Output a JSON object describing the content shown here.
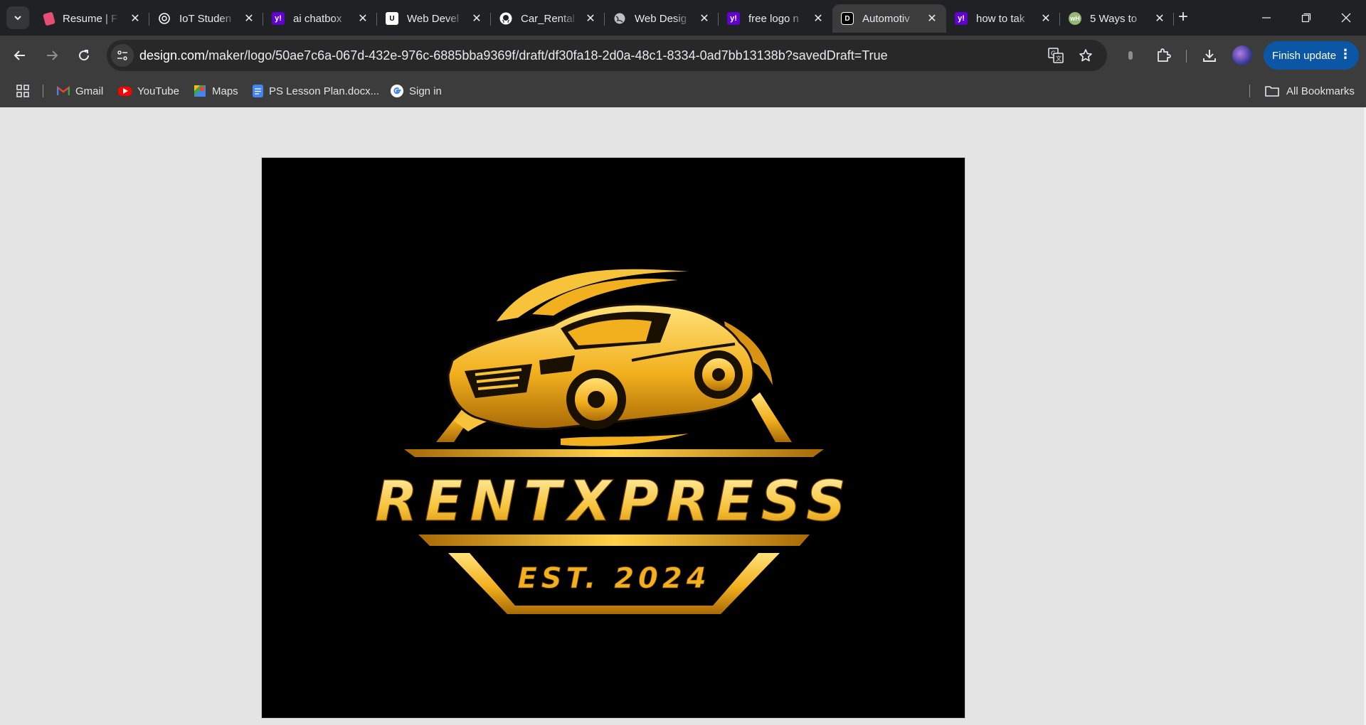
{
  "browser": {
    "tabs": [
      {
        "title": "Resume | F",
        "icon": "resume-app-icon",
        "color": "#e84d73"
      },
      {
        "title": "IoT Studen",
        "icon": "chatgpt-icon",
        "color": "#ffffff"
      },
      {
        "title": "ai chatbox",
        "icon": "yahoo-icon",
        "color": "#6001d2"
      },
      {
        "title": "Web Devel",
        "icon": "udacity-icon",
        "color": "#ffffff"
      },
      {
        "title": "Car_Rental",
        "icon": "github-icon",
        "color": "#ffffff"
      },
      {
        "title": "Web Desig",
        "icon": "globe-icon",
        "color": "#bdc1c6"
      },
      {
        "title": "free logo n",
        "icon": "yahoo-icon",
        "color": "#6001d2"
      },
      {
        "title": "Automotiv",
        "icon": "design-com-icon",
        "color": "#ffffff",
        "active": true
      },
      {
        "title": "how to tak",
        "icon": "yahoo-icon",
        "color": "#6001d2"
      },
      {
        "title": "5 Ways to",
        "icon": "wikihow-icon",
        "color": "#93b874"
      }
    ],
    "url": {
      "host": "design.com",
      "path": "/maker/logo/50ae7c6a-067d-432e-976c-6885bba9369f/draft/df30fa18-2d0a-48c1-8334-0ad7bb13138b?savedDraft=True"
    },
    "finish_update_label": "Finish update",
    "bookmarks": [
      {
        "label": "Gmail",
        "icon": "gmail-icon"
      },
      {
        "label": "YouTube",
        "icon": "youtube-icon"
      },
      {
        "label": "Maps",
        "icon": "maps-icon"
      },
      {
        "label": "PS Lesson Plan.docx...",
        "icon": "google-docs-icon"
      },
      {
        "label": "Sign in",
        "icon": "google-icon"
      }
    ],
    "all_bookmarks_label": "All Bookmarks"
  },
  "logo": {
    "brand_name": "RENTXPRESS",
    "tagline": "EST. 2024",
    "colors": {
      "gold_light": "#ffe27a",
      "gold": "#f2b01e",
      "gold_dark": "#a86a06",
      "background": "#000000"
    }
  }
}
